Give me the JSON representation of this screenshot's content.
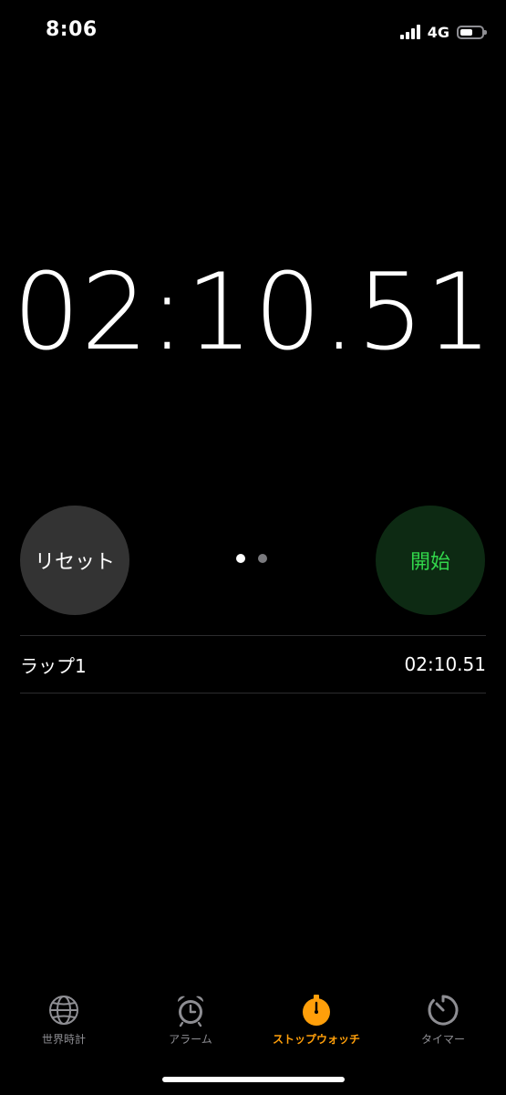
{
  "status_bar": {
    "time": "8:06",
    "network": "4G",
    "icons": [
      "signal-bars-icon",
      "battery-icon"
    ]
  },
  "stopwatch": {
    "elapsed": "02:10.51"
  },
  "controls": {
    "reset_label": "リセット",
    "start_label": "開始",
    "page_indicator": {
      "current": 1,
      "total": 2
    }
  },
  "laps": [
    {
      "label": "ラップ1",
      "time": "02:10.51"
    }
  ],
  "tab_bar": {
    "tabs": [
      {
        "label": "世界時計",
        "icon": "globe-icon",
        "active": false
      },
      {
        "label": "アラーム",
        "icon": "alarm-clock-icon",
        "active": false
      },
      {
        "label": "ストップウォッチ",
        "icon": "stopwatch-icon",
        "active": true
      },
      {
        "label": "タイマー",
        "icon": "timer-icon",
        "active": false
      }
    ]
  },
  "colors": {
    "background": "#000000",
    "accent": "#ff9f0a",
    "start_text": "#32d74b",
    "start_bg": "#0d2a13",
    "reset_bg": "#333333",
    "inactive_tab": "#8e8e93"
  }
}
